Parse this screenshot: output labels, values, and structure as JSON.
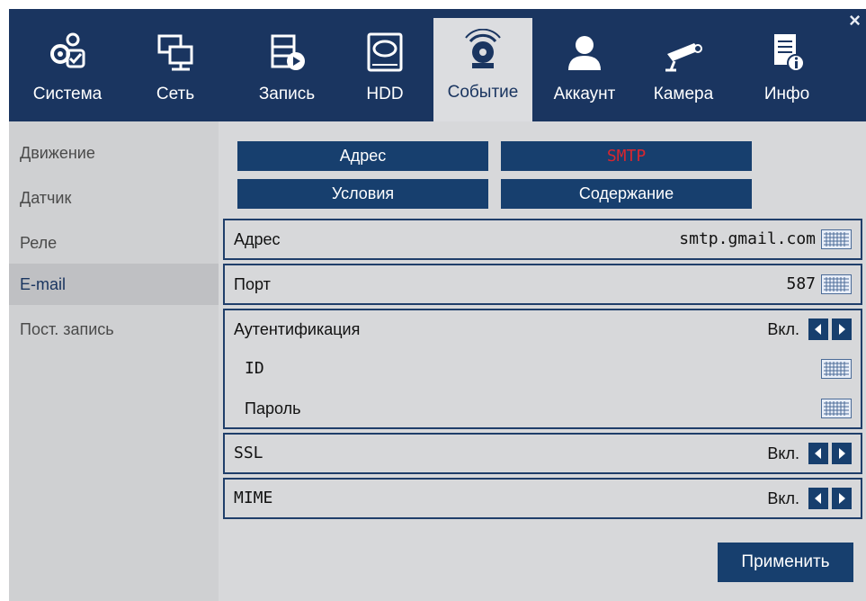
{
  "window": {
    "close_label": "×"
  },
  "tabs": [
    {
      "label": "Система",
      "icon": "system-gear-icon"
    },
    {
      "label": "Сеть",
      "icon": "network-icon"
    },
    {
      "label": "Запись",
      "icon": "record-film-icon"
    },
    {
      "label": "HDD",
      "icon": "hdd-icon"
    },
    {
      "label": "Событие",
      "icon": "alarm-siren-icon",
      "active": true
    },
    {
      "label": "Аккаунт",
      "icon": "user-account-icon"
    },
    {
      "label": "Камера",
      "icon": "camera-icon"
    },
    {
      "label": "Инфо",
      "icon": "info-document-icon"
    }
  ],
  "sidebar": {
    "items": [
      {
        "label": "Движение"
      },
      {
        "label": "Датчик"
      },
      {
        "label": "Реле"
      },
      {
        "label": "E-mail",
        "active": true
      },
      {
        "label": "Пост. запись"
      }
    ]
  },
  "subtabs": {
    "address": "Адрес",
    "smtp": "SMTP",
    "conditions": "Условия",
    "content": "Содержание"
  },
  "settings": {
    "address": {
      "label": "Адрес",
      "value": "smtp.gmail.com"
    },
    "port": {
      "label": "Порт",
      "value": "587"
    },
    "auth": {
      "label": "Аутентификация",
      "value": "Вкл."
    },
    "id": {
      "label": "ID"
    },
    "password": {
      "label": "Пароль"
    },
    "ssl": {
      "label": "SSL",
      "value": "Вкл."
    },
    "mime": {
      "label": "MIME",
      "value": "Вкл."
    }
  },
  "actions": {
    "apply": "Применить"
  },
  "colors": {
    "navy": "#1a3560",
    "button": "#173f6e",
    "smtp_red": "#d8262f",
    "panel": "#d7d8da"
  }
}
